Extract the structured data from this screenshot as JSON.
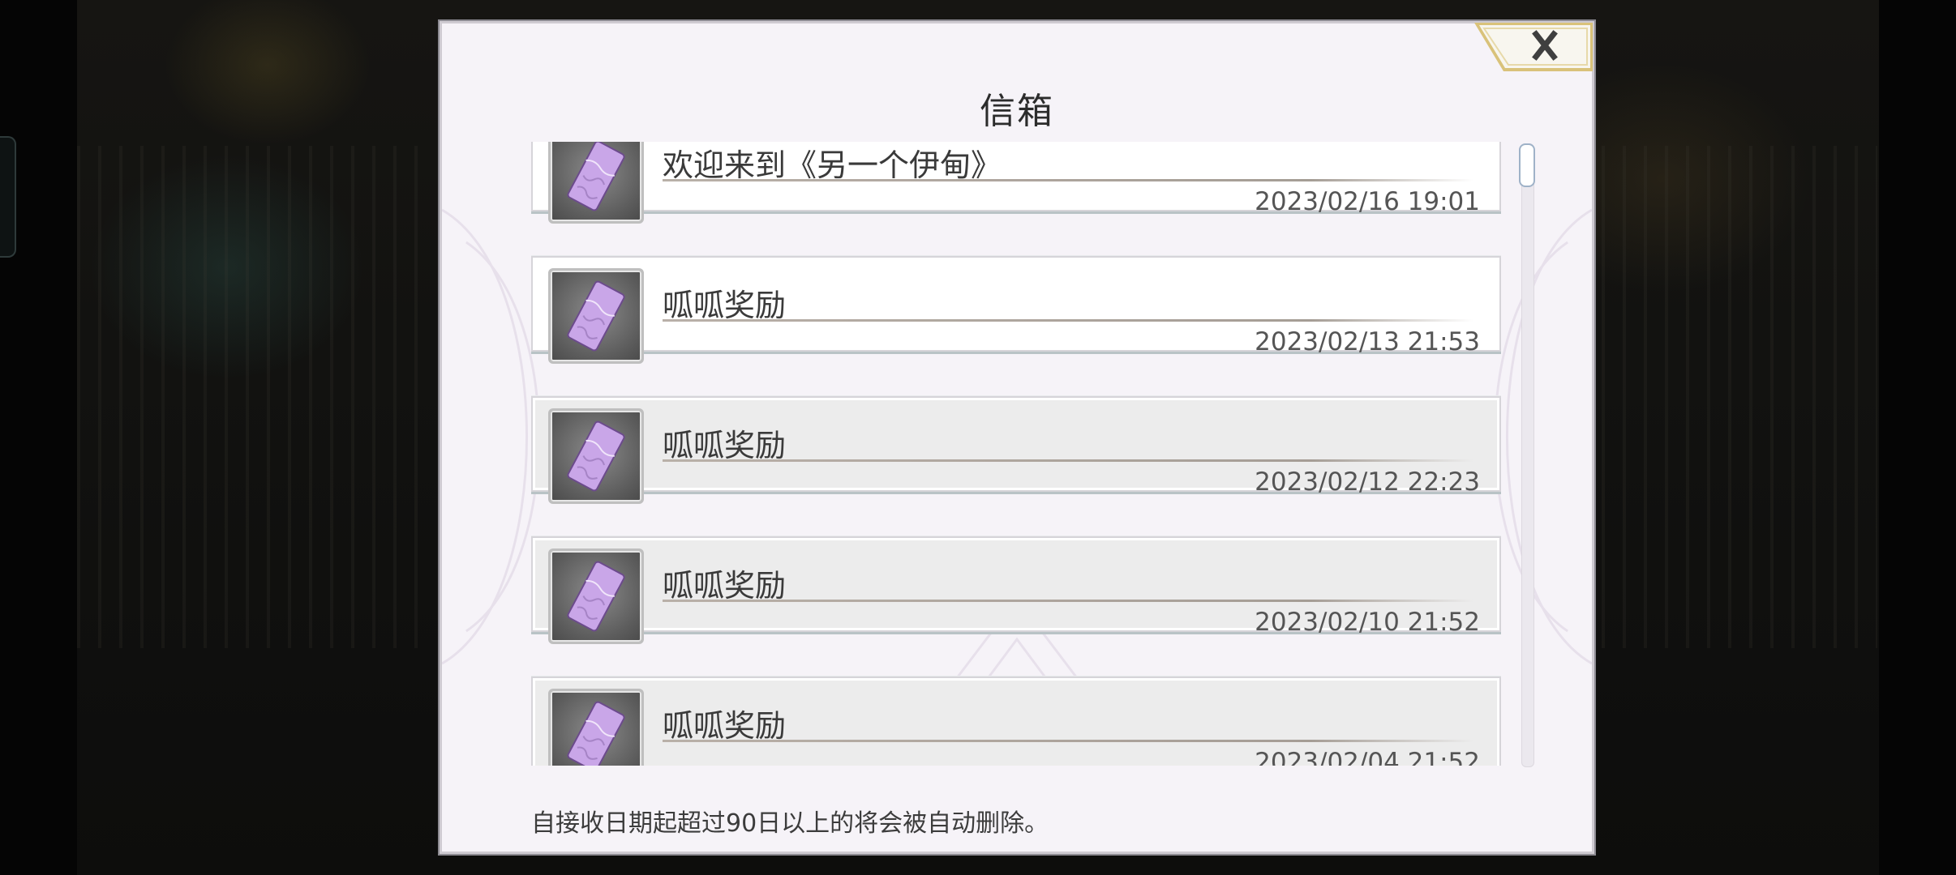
{
  "dialog": {
    "title": "信箱",
    "close_label": "×",
    "footer_note": "自接收日期起超过90日以上的将会被自动删除。"
  },
  "mails": [
    {
      "title": "欢迎来到《另一个伊甸》",
      "date": "2023/02/16 19:01",
      "read": false
    },
    {
      "title": "呱呱奖励",
      "date": "2023/02/13 21:53",
      "read": false
    },
    {
      "title": "呱呱奖励",
      "date": "2023/02/12 22:23",
      "read": true
    },
    {
      "title": "呱呱奖励",
      "date": "2023/02/10 21:52",
      "read": true
    },
    {
      "title": "呱呱奖励",
      "date": "2023/02/04 21:52",
      "read": true
    }
  ],
  "icons": {
    "mail_item": "voucher-ticket-icon",
    "close": "close-icon"
  },
  "colors": {
    "dialog_bg": "#f6f3f8",
    "close_gold": "#c9a64a",
    "ticket_purple": "#c9a6e8",
    "scroll_thumb_border": "#9fb2c8"
  }
}
